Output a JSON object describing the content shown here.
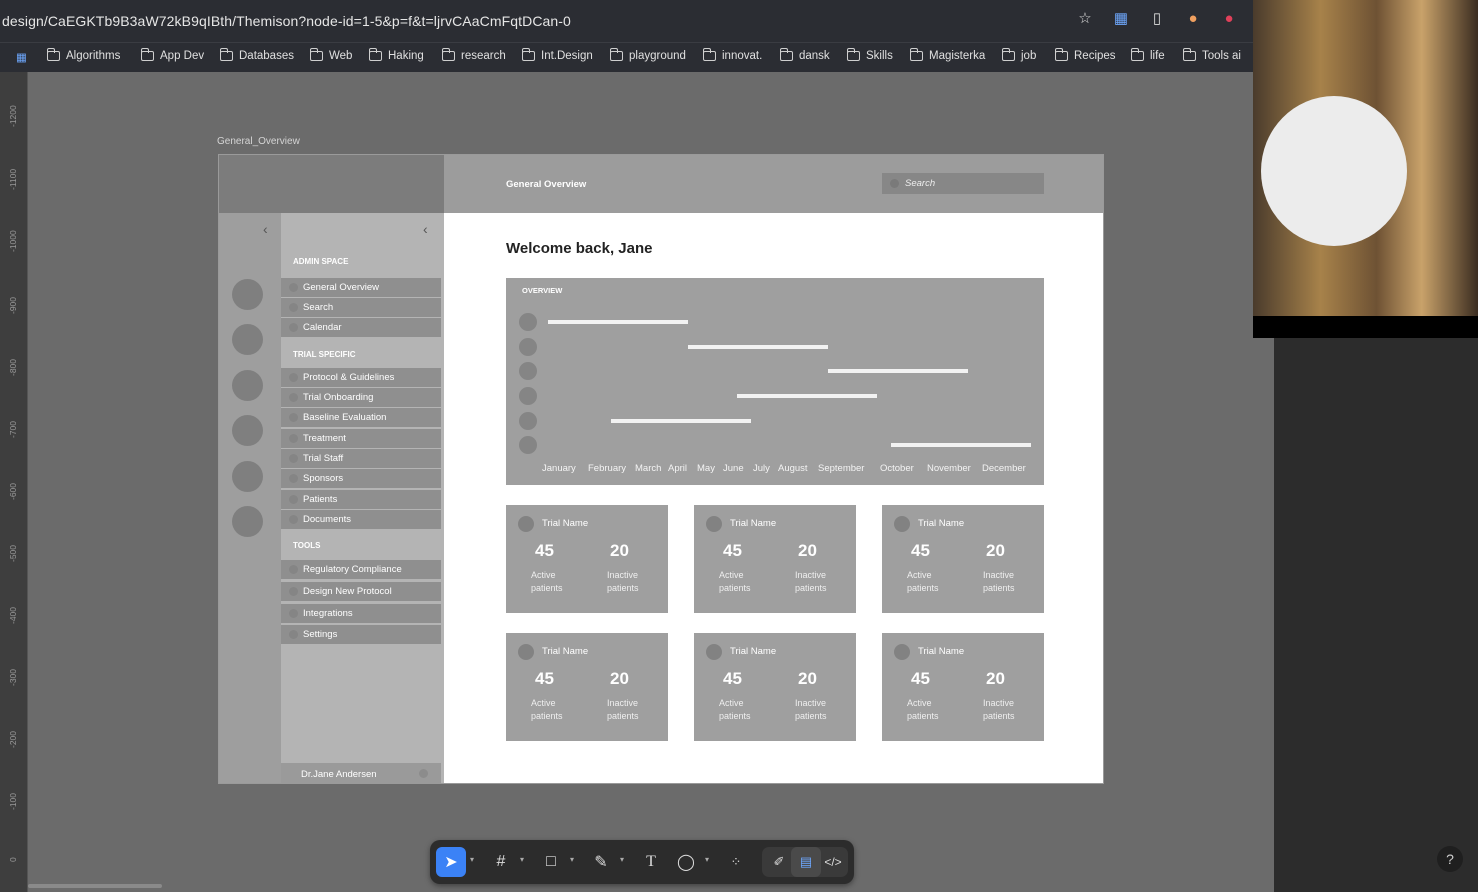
{
  "browser": {
    "url": "design/CaEGKTb9B3aW72kB9qIBth/Themison?node-id=1-5&p=f&t=ljrvCAaCmFqtDCan-0",
    "bookmarks": [
      "Algorithms",
      "App Dev",
      "Databases",
      "Web",
      "Haking",
      "research",
      "Int.Design",
      "playground",
      "innovat.",
      "dansk",
      "Skills",
      "Magisterka",
      "job",
      "Recipes",
      "life",
      "Tools ai"
    ]
  },
  "ruler": {
    "ticks": [
      "-1200",
      "-1100",
      "-1000",
      "-900",
      "-800",
      "-700",
      "-600",
      "-500",
      "-400",
      "-300",
      "-200",
      "-100",
      "0"
    ]
  },
  "frame": {
    "label": "General_Overview",
    "header_title": "General Overview",
    "search_placeholder": "Search",
    "welcome": "Welcome back, Jane",
    "sidebar": {
      "sections": [
        {
          "title": "ADMIN SPACE",
          "items": [
            "General Overview",
            "Search",
            "Calendar"
          ]
        },
        {
          "title": "TRIAL SPECIFIC",
          "items": [
            "Protocol & Guidelines",
            "Trial Onboarding",
            "Baseline Evaluation",
            "Treatment",
            "Trial Staff",
            "Sponsors",
            "Patients",
            "Documents"
          ]
        },
        {
          "title": "TOOLS",
          "items": [
            "Regulatory Compliance",
            "Design New Protocol",
            "Integrations",
            "Settings"
          ]
        }
      ],
      "user": "Dr.Jane Andersen"
    },
    "overview": {
      "title": "OVERVIEW",
      "months": [
        "January",
        "February",
        "March",
        "April",
        "May",
        "June",
        "July",
        "August",
        "September",
        "October",
        "November",
        "December"
      ]
    },
    "cards": [
      {
        "name": "Trial Name",
        "active": "45",
        "inactive": "20",
        "active_label_1": "Active",
        "active_label_2": "patients",
        "inactive_label_1": "Inactive",
        "inactive_label_2": "patients"
      },
      {
        "name": "Trial Name",
        "active": "45",
        "inactive": "20",
        "active_label_1": "Active",
        "active_label_2": "patients",
        "inactive_label_1": "Inactive",
        "inactive_label_2": "patients"
      },
      {
        "name": "Trial Name",
        "active": "45",
        "inactive": "20",
        "active_label_1": "Active",
        "active_label_2": "patients",
        "inactive_label_1": "Inactive",
        "inactive_label_2": "patients"
      },
      {
        "name": "Trial Name",
        "active": "45",
        "inactive": "20",
        "active_label_1": "Active",
        "active_label_2": "patients",
        "inactive_label_1": "Inactive",
        "inactive_label_2": "patients"
      },
      {
        "name": "Trial Name",
        "active": "45",
        "inactive": "20",
        "active_label_1": "Active",
        "active_label_2": "patients",
        "inactive_label_1": "Inactive",
        "inactive_label_2": "patients"
      },
      {
        "name": "Trial Name",
        "active": "45",
        "inactive": "20",
        "active_label_1": "Active",
        "active_label_2": "patients",
        "inactive_label_1": "Inactive",
        "inactive_label_2": "patients"
      }
    ]
  },
  "help_label": "?",
  "colors": {
    "accent": "#3b82f6",
    "canvas": "#6b6b6b",
    "chrome": "#2b2d33"
  }
}
